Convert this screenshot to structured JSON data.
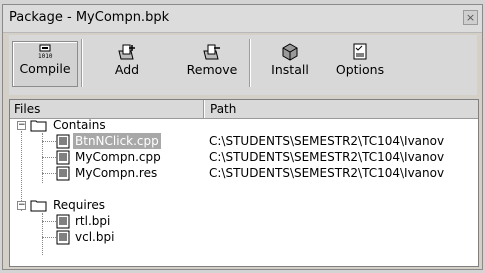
{
  "window": {
    "title": "Package - MyCompn.bpk",
    "close_glyph": "×"
  },
  "toolbar": {
    "buttons": [
      {
        "label": "Compile",
        "icon": "compile-icon"
      },
      {
        "label": "Add",
        "icon": "add-icon"
      },
      {
        "label": "Remove",
        "icon": "remove-icon"
      },
      {
        "label": "Install",
        "icon": "install-icon"
      },
      {
        "label": "Options",
        "icon": "options-icon"
      }
    ]
  },
  "columns": {
    "files": "Files",
    "path": "Path"
  },
  "tree": {
    "contains": {
      "label": "Contains",
      "items": [
        {
          "name": "BtnNClick.cpp",
          "path": "C:\\STUDENTS\\SEMESTR2\\TC104\\Ivanov",
          "selected": true
        },
        {
          "name": "MyCompn.cpp",
          "path": "C:\\STUDENTS\\SEMESTR2\\TC104\\Ivanov"
        },
        {
          "name": "MyCompn.res",
          "path": "C:\\STUDENTS\\SEMESTR2\\TC104\\Ivanov"
        }
      ]
    },
    "requires": {
      "label": "Requires",
      "items": [
        {
          "name": "rtl.bpi"
        },
        {
          "name": "vcl.bpi"
        }
      ]
    },
    "expander_glyph": "−"
  }
}
